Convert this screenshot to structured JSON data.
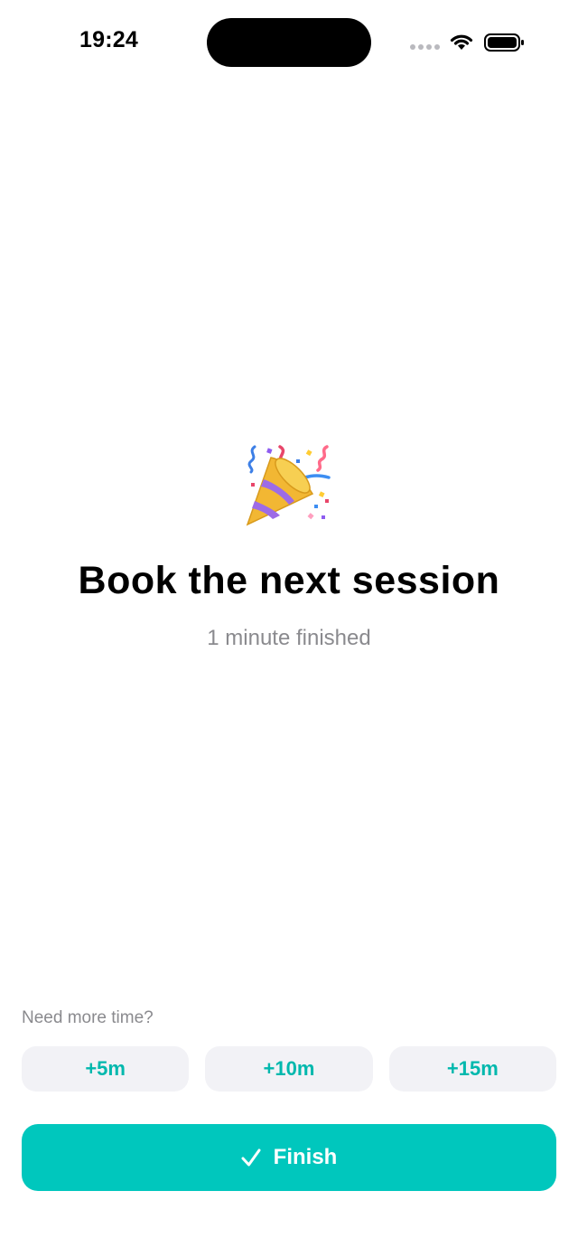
{
  "status_bar": {
    "time": "19:24",
    "icons": [
      "signal-dots-icon",
      "wifi-icon",
      "battery-icon"
    ]
  },
  "main": {
    "icon": "party-popper-icon",
    "title": "Book the next session",
    "subtitle": "1 minute finished"
  },
  "extend": {
    "label": "Need more time?",
    "options": [
      {
        "label": "+5m"
      },
      {
        "label": "+10m"
      },
      {
        "label": "+15m"
      }
    ]
  },
  "finish": {
    "icon": "checkmark-icon",
    "label": "Finish"
  },
  "colors": {
    "accent": "#00c7bd",
    "accent_text": "#00b8ad",
    "chip_bg": "#f2f2f6",
    "muted_text": "#8a8a8e"
  }
}
